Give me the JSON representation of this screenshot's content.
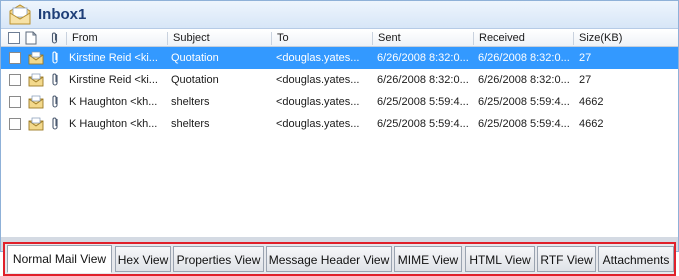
{
  "window": {
    "title": "Inbox1",
    "title_icon": "mail-folder-icon"
  },
  "columns": {
    "checkbox_icon": "checkbox",
    "type_icon": "document-icon",
    "attachment_icon": "paperclip-icon",
    "from": "From",
    "subject": "Subject",
    "to": "To",
    "sent": "Sent",
    "received": "Received",
    "size": "Size(KB)"
  },
  "messages": [
    {
      "from": "Kirstine Reid <ki...",
      "subject": "Quotation",
      "to": "<douglas.yates...",
      "sent": "6/26/2008 8:32:0...",
      "received": "6/26/2008 8:32:0...",
      "size": "27",
      "selected": true
    },
    {
      "from": "Kirstine Reid <ki...",
      "subject": "Quotation",
      "to": "<douglas.yates...",
      "sent": "6/26/2008 8:32:0...",
      "received": "6/26/2008 8:32:0...",
      "size": "27",
      "selected": false
    },
    {
      "from": "K Haughton <kh...",
      "subject": "shelters",
      "to": "<douglas.yates...",
      "sent": "6/25/2008 5:59:4...",
      "received": "6/25/2008 5:59:4...",
      "size": "4662",
      "selected": false
    },
    {
      "from": "K Haughton <kh...",
      "subject": "shelters",
      "to": "<douglas.yates...",
      "sent": "6/25/2008 5:59:4...",
      "received": "6/25/2008 5:59:4...",
      "size": "4662",
      "selected": false
    }
  ],
  "tabs": [
    {
      "label": "Normal Mail View",
      "active": true
    },
    {
      "label": "Hex View",
      "active": false
    },
    {
      "label": "Properties View",
      "active": false
    },
    {
      "label": "Message Header View",
      "active": false
    },
    {
      "label": "MIME View",
      "active": false
    },
    {
      "label": "HTML View",
      "active": false
    },
    {
      "label": "RTF View",
      "active": false
    },
    {
      "label": "Attachments",
      "active": false
    }
  ],
  "colors": {
    "selection": "#3399ff",
    "tab_highlight_border": "#e0202a",
    "title_text": "#1e3e78"
  }
}
